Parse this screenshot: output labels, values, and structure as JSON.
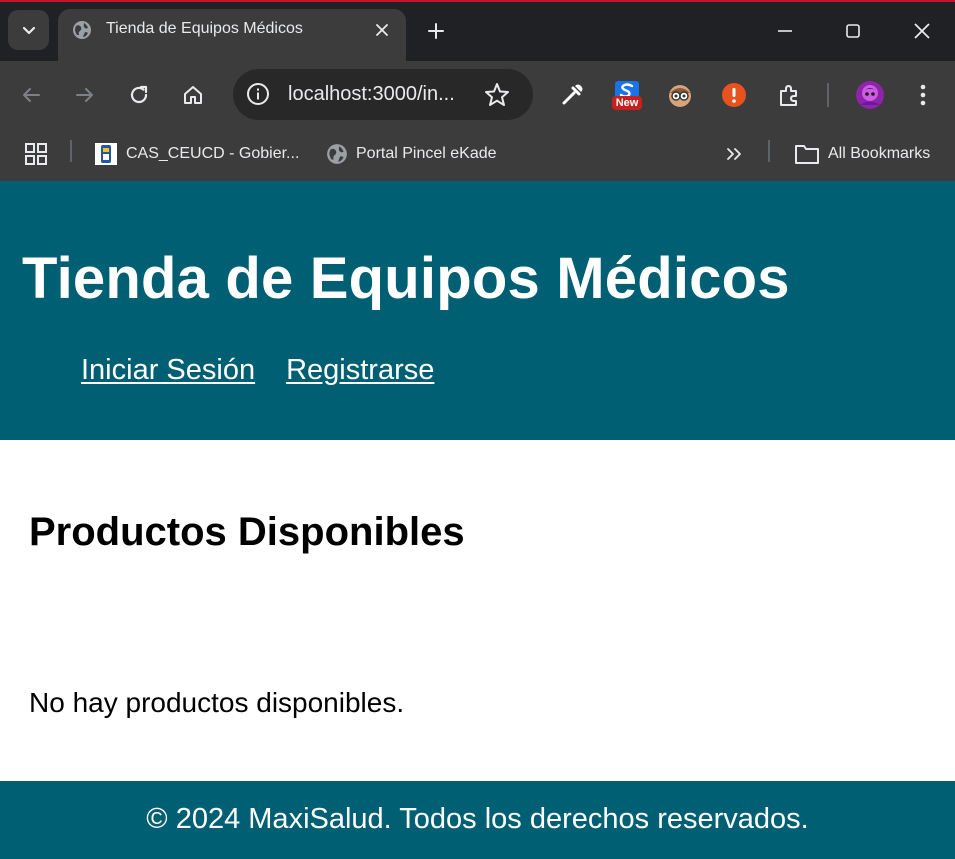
{
  "browser": {
    "tab": {
      "title": "Tienda de Equipos Médicos"
    },
    "omnibox": {
      "url": "localhost:3000/in..."
    },
    "extensions": {
      "new_badge": "New"
    },
    "bookmarks": [
      {
        "label": "CAS_CEUCD - Gobier..."
      },
      {
        "label": "Portal Pincel eKade"
      }
    ],
    "all_bookmarks_label": "All Bookmarks"
  },
  "header": {
    "title": "Tienda de Equipos Médicos",
    "nav": [
      {
        "label": "Iniciar Sesión"
      },
      {
        "label": "Registrarse"
      }
    ]
  },
  "main": {
    "section_title": "Productos Disponibles",
    "empty_message": "No hay productos disponibles."
  },
  "footer": {
    "copyright": "© 2024 MaxiSalud. Todos los derechos reservados."
  },
  "colors": {
    "brand": "#005f73",
    "chrome_dark": "#202124",
    "chrome_toolbar": "#3c3c3c",
    "alert_red": "#e8521f",
    "badge_red": "#c5221f"
  }
}
